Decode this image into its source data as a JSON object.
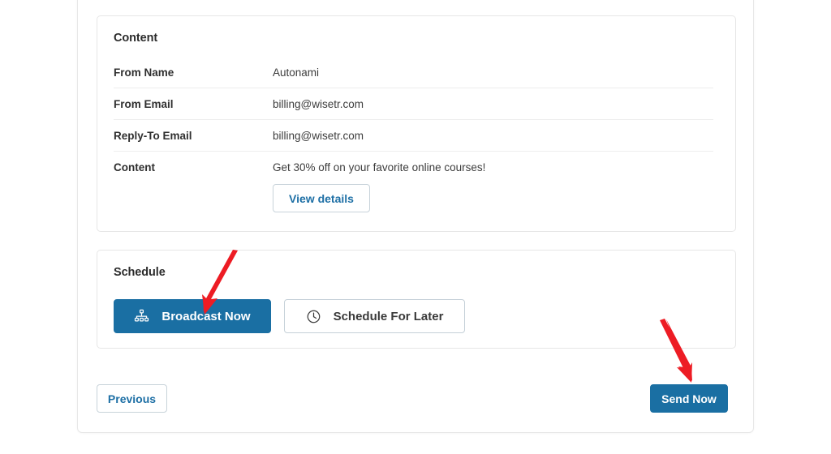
{
  "content_card": {
    "title": "Content",
    "rows": [
      {
        "label": "From Name",
        "value": "Autonami"
      },
      {
        "label": "From Email",
        "value": "billing@wisetr.com"
      },
      {
        "label": "Reply-To Email",
        "value": "billing@wisetr.com"
      },
      {
        "label": "Content",
        "value": "Get 30% off on your favorite online courses!"
      }
    ],
    "view_details_label": "View details"
  },
  "schedule_card": {
    "title": "Schedule",
    "options": [
      {
        "label": "Broadcast Now",
        "icon": "sitemap-icon",
        "selected": true
      },
      {
        "label": "Schedule For Later",
        "icon": "clock-icon",
        "selected": false
      }
    ]
  },
  "footer": {
    "previous_label": "Previous",
    "send_now_label": "Send Now"
  },
  "annotations": [
    {
      "name": "arrow-to-broadcast-now",
      "color": "#ED1C24",
      "direction": "down-left"
    },
    {
      "name": "arrow-to-send-now",
      "color": "#ED1C24",
      "direction": "down-right"
    }
  ],
  "colors": {
    "primary": "#1a6fa3",
    "link": "#1d6fa5",
    "border": "#e6e6e6",
    "row_divider": "#ededed",
    "annotation_red": "#ED1C24"
  }
}
